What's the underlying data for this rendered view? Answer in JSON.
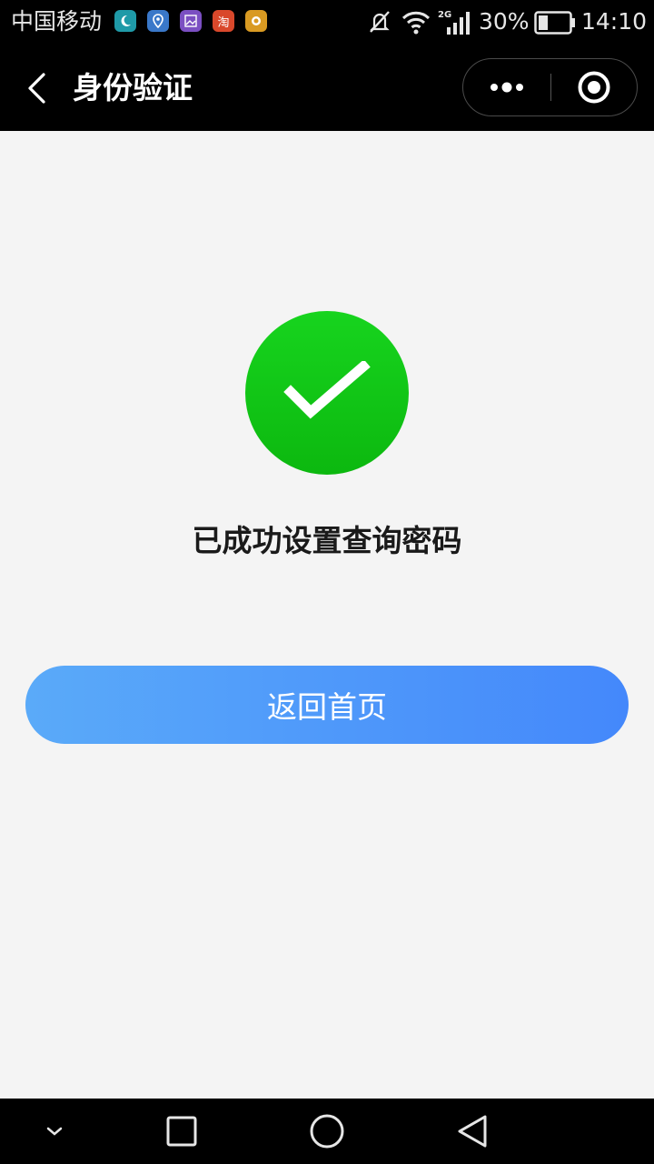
{
  "status_bar": {
    "carrier": "中国移动",
    "notifications": [
      "moon-app-icon",
      "location-app-icon",
      "gallery-app-icon",
      "taobao-app-icon",
      "hand-app-icon"
    ],
    "taobao_glyph": "淘",
    "network": "2G",
    "battery_percent": "30%",
    "battery_level": 0.3,
    "time": "14:10"
  },
  "nav": {
    "title": "身份验证",
    "icons": [
      "back-arrow-icon",
      "more-dots-icon",
      "close-target-icon"
    ]
  },
  "main": {
    "status_icon": "checkmark-icon",
    "message": "已成功设置查询密码",
    "home_button_label": "返回首页"
  },
  "colors": {
    "success_green": "#12c816",
    "button_gradient_start": "#5aaaf9",
    "button_gradient_end": "#4488fb",
    "page_background": "#f4f4f4"
  },
  "system_nav": {
    "icons": [
      "chevron-down-icon",
      "recent-apps-square-icon",
      "home-circle-icon",
      "back-triangle-icon"
    ]
  }
}
